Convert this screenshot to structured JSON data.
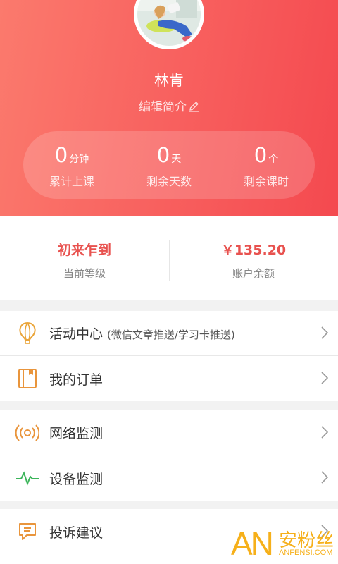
{
  "profile": {
    "name": "林肯",
    "edit_intro": "编辑简介"
  },
  "stats": [
    {
      "value": "0",
      "unit": "分钟",
      "label": "累计上课"
    },
    {
      "value": "0",
      "unit": "天",
      "label": "剩余天数"
    },
    {
      "value": "0",
      "unit": "个",
      "label": "剩余课时"
    }
  ],
  "account": {
    "level_value": "初来乍到",
    "level_label": "当前等级",
    "balance_value": "￥135.20",
    "balance_label": "账户余额"
  },
  "menu": {
    "activity": {
      "label": "活动中心",
      "sub": "(微信文章推送/学习卡推送)",
      "icon": "lightbulb-icon"
    },
    "orders": {
      "label": "我的订单",
      "icon": "order-book-icon"
    },
    "network": {
      "label": "网络监测",
      "icon": "signal-broadcast-icon"
    },
    "device": {
      "label": "设备监测",
      "icon": "pulse-icon"
    },
    "feedback": {
      "label": "投诉建议",
      "icon": "message-icon"
    }
  },
  "watermark": {
    "brand": "AN",
    "cn": "安粉丝",
    "en": "ANFENSI.COM"
  },
  "colors": {
    "header_start": "#fb7a6d",
    "header_end": "#f4494f",
    "accent_red": "#e8524f",
    "icon_orange": "#e9953c",
    "icon_green": "#3bb55a",
    "watermark": "#f6b01a"
  }
}
